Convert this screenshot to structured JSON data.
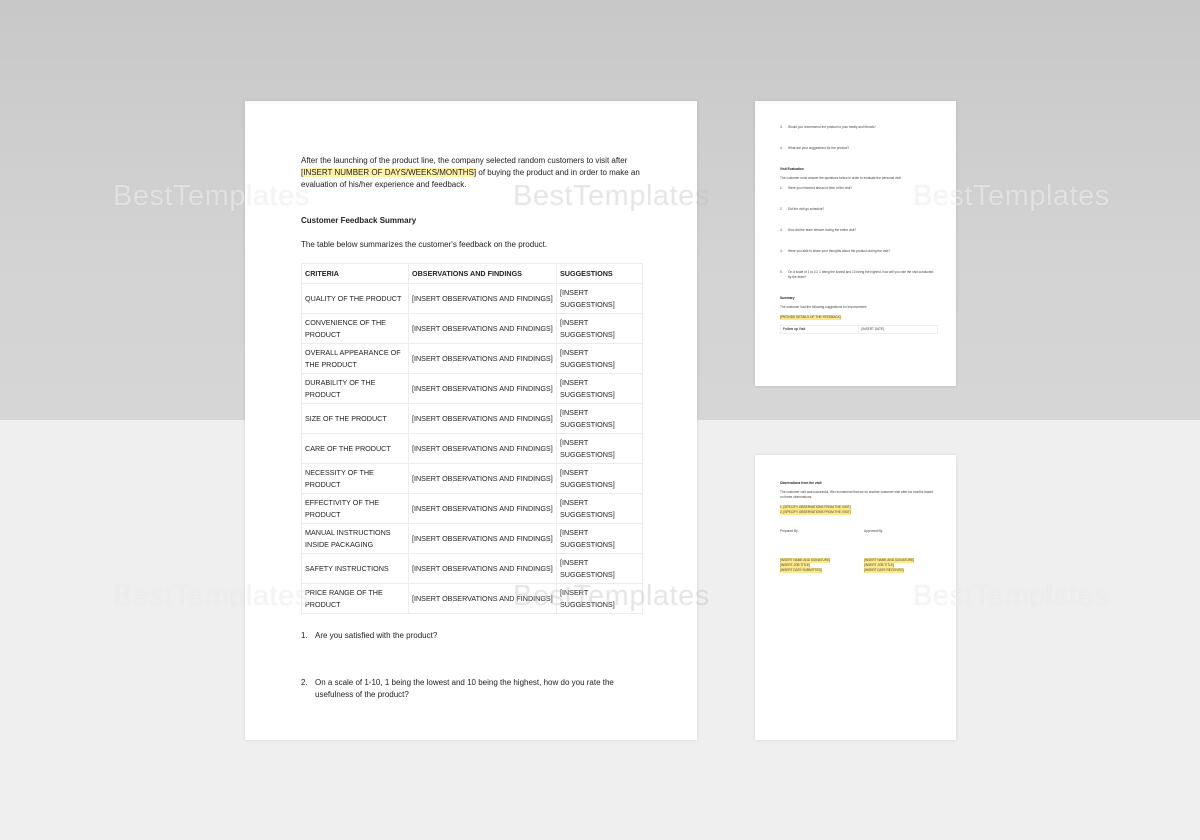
{
  "watermark": "BestTemplates",
  "main_page": {
    "intro": {
      "before": "After the launching of the product line, the company selected random customers to visit after ",
      "highlight": "[INSERT NUMBER OF DAYS/WEEKS/MONTHS]",
      "after": " of buying the product and in order to make an evaluation of his/her experience and feedback."
    },
    "section_title": "Customer Feedback Summary",
    "section_desc": "The table below summarizes the customer's feedback on the product.",
    "table": {
      "headers": [
        "CRITERIA",
        "OBSERVATIONS AND FINDINGS",
        "SUGGESTIONS"
      ],
      "rows": [
        [
          "QUALITY OF THE PRODUCT",
          "[INSERT OBSERVATIONS AND FINDINGS]",
          "[INSERT SUGGESTIONS]"
        ],
        [
          "CONVENIENCE OF THE PRODUCT",
          "[INSERT OBSERVATIONS AND FINDINGS]",
          "[INSERT SUGGESTIONS]"
        ],
        [
          "OVERALL APPEARANCE OF THE PRODUCT",
          "[INSERT OBSERVATIONS AND FINDINGS]",
          "[INSERT SUGGESTIONS]"
        ],
        [
          "DURABILITY OF THE PRODUCT",
          "[INSERT OBSERVATIONS AND FINDINGS]",
          "[INSERT SUGGESTIONS]"
        ],
        [
          "SIZE OF THE PRODUCT",
          "[INSERT OBSERVATIONS AND FINDINGS]",
          "[INSERT SUGGESTIONS]"
        ],
        [
          "CARE OF THE PRODUCT",
          "[INSERT OBSERVATIONS AND FINDINGS]",
          "[INSERT SUGGESTIONS]"
        ],
        [
          "NECESSITY OF THE PRODUCT",
          "[INSERT OBSERVATIONS AND FINDINGS]",
          "[INSERT SUGGESTIONS]"
        ],
        [
          "EFFECTIVITY OF THE PRODUCT",
          "[INSERT OBSERVATIONS AND FINDINGS]",
          "[INSERT SUGGESTIONS]"
        ],
        [
          "MANUAL INSTRUCTIONS INSIDE PACKAGING",
          "[INSERT OBSERVATIONS AND FINDINGS]",
          "[INSERT SUGGESTIONS]"
        ],
        [
          "SAFETY INSTRUCTIONS",
          "[INSERT OBSERVATIONS AND FINDINGS]",
          "[INSERT SUGGESTIONS]"
        ],
        [
          "PRICE RANGE OF THE PRODUCT",
          "[INSERT OBSERVATIONS AND FINDINGS]",
          "[INSERT SUGGESTIONS]"
        ]
      ]
    },
    "questions": [
      {
        "num": "1.",
        "text": "Are you satisfied with the product?"
      },
      {
        "num": "2.",
        "text": "On a scale of 1-10, 1 being the lowest and 10 being the highest, how do you rate the usefulness of the product?"
      }
    ]
  },
  "side_page_top": {
    "questions": [
      {
        "num": "3.",
        "text": "Would you recommend the product to your family and friends?"
      },
      {
        "num": "4.",
        "text": "What are your suggestions for the product?"
      }
    ],
    "visit_title": "Visit Evaluation",
    "visit_desc": "The customer must answer the questions below in order to evaluate the personal visit.",
    "visit_questions": [
      {
        "num": "1.",
        "text": "Were you informed ahead of time of the visit?"
      },
      {
        "num": "2.",
        "text": "Did the visit go schedule?"
      },
      {
        "num": "3.",
        "text": "How did the team behave during the entire visit?"
      },
      {
        "num": "4.",
        "text": "Were you able to share your thoughts about the product during the visit?"
      },
      {
        "num": "5.",
        "text": "On a scale of 1 to 10, 1 being the lowest and 10 being the highest, how will you rate the visit conducted by the team?"
      }
    ],
    "summary_title": "Summary",
    "summary_desc": "The customer had the following suggestions for improvement:",
    "summary_highlight": "[PROVIDE DETAILS OF THE FEEDBACK]",
    "followup_label": "Follow up Visit",
    "followup_value": "[INSERT DATE]"
  },
  "side_page_bottom": {
    "obs_title": "Observations from the visit:",
    "obs_desc": "The customer visit was successful. We recommend that we do another customer visit after six months based on these observations.",
    "obs_items": [
      "1.  [SPECIFY OBSERVATIONS FROM THE VISIT]",
      "2.  [SPECIFY OBSERVATIONS FROM THE VISIT]"
    ],
    "prepared_label": "Prepared By:",
    "approved_label": "Approved By:",
    "prepared_lines": [
      "[INSERT NAME AND SIGNATURE]",
      "[INSERT JOB TITLE]",
      "[INSERT DATE SUBMITTED]"
    ],
    "approved_lines": [
      "[INSERT NAME AND SIGNATURE]",
      "[INSERT JOB TITLE]",
      "[INSERT DATE RECEIVED]"
    ]
  }
}
